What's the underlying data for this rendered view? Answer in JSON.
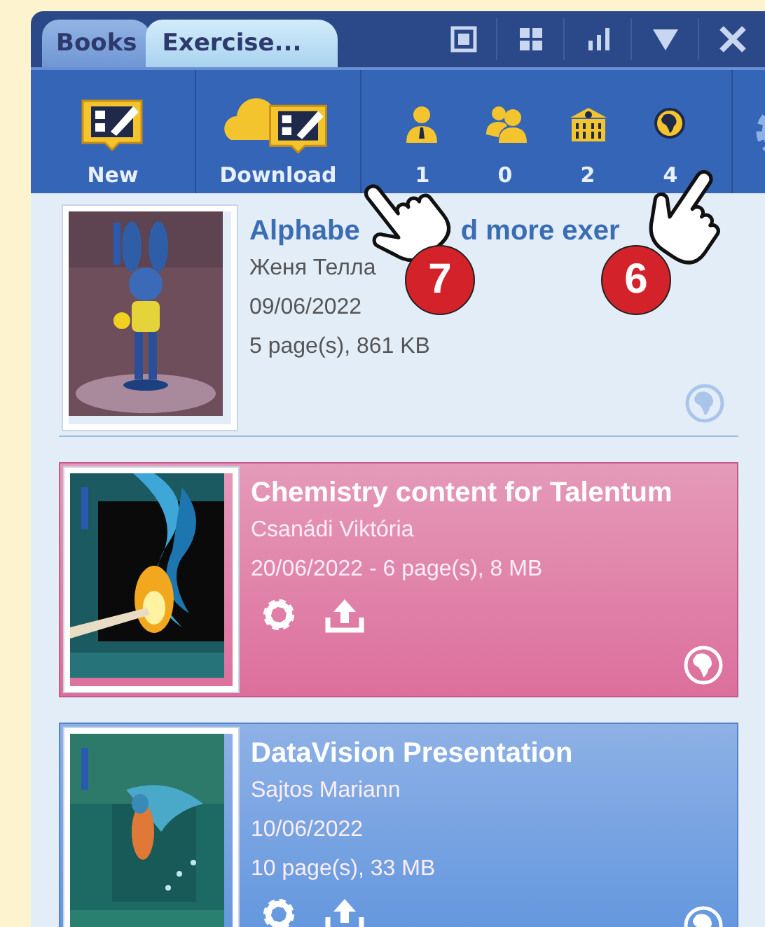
{
  "tabs": [
    {
      "label": "Books",
      "selected": false
    },
    {
      "label": "Exercise...",
      "selected": true
    }
  ],
  "window_controls": [
    {
      "kind": "single"
    },
    {
      "kind": "grid"
    },
    {
      "kind": "chart"
    },
    {
      "kind": "dropdown"
    },
    {
      "kind": "close"
    }
  ],
  "toolbar": {
    "actions": [
      {
        "kind": "new",
        "label": "New"
      },
      {
        "kind": "download",
        "label": "Download"
      }
    ],
    "counters": [
      {
        "kind": "person",
        "count": "1"
      },
      {
        "kind": "group",
        "count": "0"
      },
      {
        "kind": "school",
        "count": "2"
      },
      {
        "kind": "world",
        "count": "4"
      }
    ]
  },
  "books": [
    {
      "kind": "plain",
      "title_parts": [
        "Alphabe",
        "d more exer"
      ],
      "author": "Женя Телла",
      "lines": [
        "09/06/2022",
        "5 page(s), 861 KB"
      ],
      "editable": false
    },
    {
      "kind": "pink",
      "title_parts": [
        "Chemistry content for Talentum"
      ],
      "author": "Csanádi Viktória",
      "lines": [
        "20/06/2022 - 6 page(s), 8 MB"
      ],
      "editable": true
    },
    {
      "kind": "blue",
      "title_parts": [
        "DataVision Presentation"
      ],
      "author": "Sajtos Mariann",
      "lines": [
        "10/06/2022",
        "10 page(s), 33 MB"
      ],
      "editable": true
    }
  ],
  "annotations": [
    {
      "number": "7"
    },
    {
      "number": "6"
    }
  ]
}
